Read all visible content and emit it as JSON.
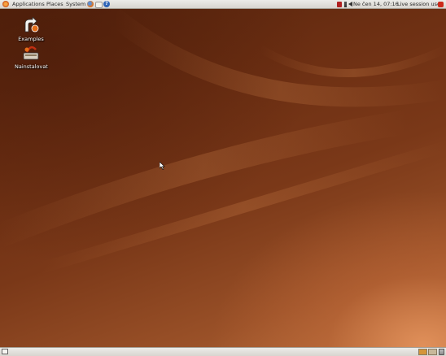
{
  "top_panel": {
    "menus": {
      "applications": "Applications",
      "places": "Places",
      "system": "System"
    },
    "launchers": [
      "firefox-icon",
      "mail-icon",
      "help-icon"
    ],
    "tray": {
      "icons": [
        "keyboard-layout-icon",
        "network-icon",
        "volume-icon"
      ],
      "clock": "Ne čen 14, 07:16",
      "user": "Live session user",
      "user_icon": "shutdown-icon"
    }
  },
  "desktop": {
    "icons": [
      {
        "label": "Examples",
        "icon": "examples-folder-icon"
      },
      {
        "label": "Nainstalovat",
        "icon": "install-icon"
      }
    ]
  },
  "bottom_panel": {
    "show_desktop_icon": "show-desktop-icon",
    "workspaces": 2,
    "active_workspace": 1,
    "trash_icon": "trash-icon"
  },
  "colors": {
    "panel": "#e6e4df",
    "wallpaper_dark": "#55230c",
    "wallpaper_light": "#b8713f",
    "accent_orange": "#e07a1f"
  }
}
